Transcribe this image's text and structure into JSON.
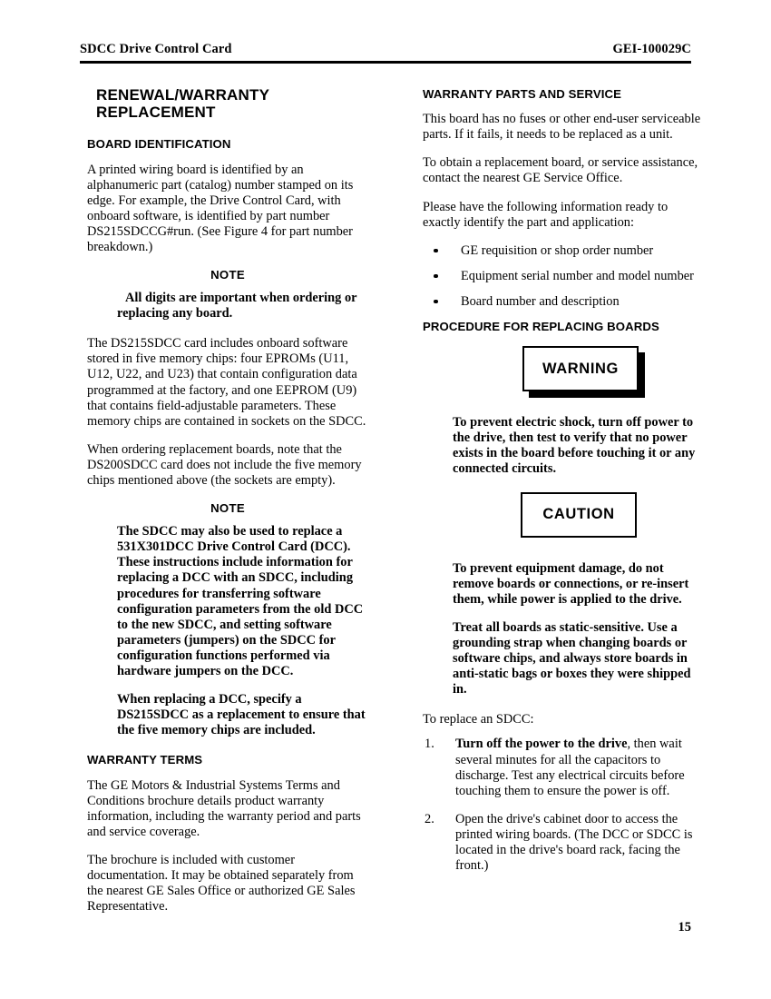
{
  "header": {
    "left": "SDCC Drive Control Card",
    "right": "GEI-100029C"
  },
  "page_number": "15",
  "left_column": {
    "doc_title": "RENEWAL/WARRANTY REPLACEMENT",
    "board_identification": {
      "heading": "BOARD IDENTIFICATION",
      "para1": "A printed wiring board is identified by an alphanumeric part (catalog) number stamped on its edge. For example, the Drive Control Card, with onboard software, is identified by part number DS215SDCCG#run. (See Figure 4 for part number breakdown.)",
      "note1_label": "NOTE",
      "note1_body": "All digits are important when ordering or replacing any board.",
      "para2": "The DS215SDCC card includes onboard software stored in five memory chips: four EPROMs (U11, U12, U22, and U23) that contain configuration data programmed at the factory, and one EEPROM (U9) that contains field-adjustable parameters. These memory chips are contained in sockets on the SDCC.",
      "para3": "When ordering replacement boards, note that the DS200SDCC card does not include the five memory chips mentioned above (the sockets are empty).",
      "note2_label": "NOTE",
      "note2_body_a": "The SDCC may also be used to replace a 531X301DCC Drive Control Card (DCC). These instructions include information for replacing a DCC with an SDCC, including procedures for transferring software configuration parameters from the old DCC to the new SDCC, and setting software parameters (jumpers) on the SDCC for configuration functions performed via hardware jumpers on the DCC.",
      "note2_body_b": "When replacing a DCC, specify a DS215SDCC as a replacement to ensure that the five memory chips are included."
    },
    "warranty_terms": {
      "heading": "WARRANTY TERMS",
      "para1": "The GE Motors & Industrial Systems Terms and Conditions brochure details product warranty information, including the warranty period and parts and service coverage.",
      "para2": "The brochure is included with customer documentation. It may be obtained separately from the nearest GE Sales Office or authorized GE Sales Representative."
    }
  },
  "right_column": {
    "warranty_parts": {
      "heading": "WARRANTY PARTS AND SERVICE",
      "para1": "This board has no fuses or other end-user serviceable parts. If it fails, it needs to be replaced as a unit.",
      "para2": "To obtain a replacement board, or service assistance, contact the nearest GE Service Office.",
      "para3": "Please have the following information ready to exactly identify the part and application:",
      "bullets": [
        "GE requisition or shop order number",
        "Equipment serial number and model number",
        "Board number and description"
      ]
    },
    "procedure": {
      "heading": "PROCEDURE FOR REPLACING BOARDS",
      "warning_label": "WARNING",
      "warning_text": "To prevent electric shock, turn off power to the drive, then test to verify that no power exists in the board before touching it or any connected circuits.",
      "caution_label": "CAUTION",
      "caution_text_1": "To prevent equipment damage, do not remove boards or connections, or re-insert them, while power is applied to the drive.",
      "caution_text_2": "Treat all boards as static-sensitive. Use a grounding strap when changing boards or software chips, and always store boards in anti-static bags or boxes they were shipped in.",
      "intro": "To replace an SDCC:",
      "steps": [
        {
          "number": "1.",
          "bold_lead": "Turn off the power to the drive",
          "rest": ", then wait several minutes for all the capacitors to discharge. Test any electrical circuits before touching them to ensure the power is off."
        },
        {
          "number": "2.",
          "bold_lead": "",
          "rest": "Open the drive's cabinet door to access the printed wiring boards. (The DCC or SDCC is located in the drive's board rack, facing the front.)"
        }
      ]
    }
  }
}
